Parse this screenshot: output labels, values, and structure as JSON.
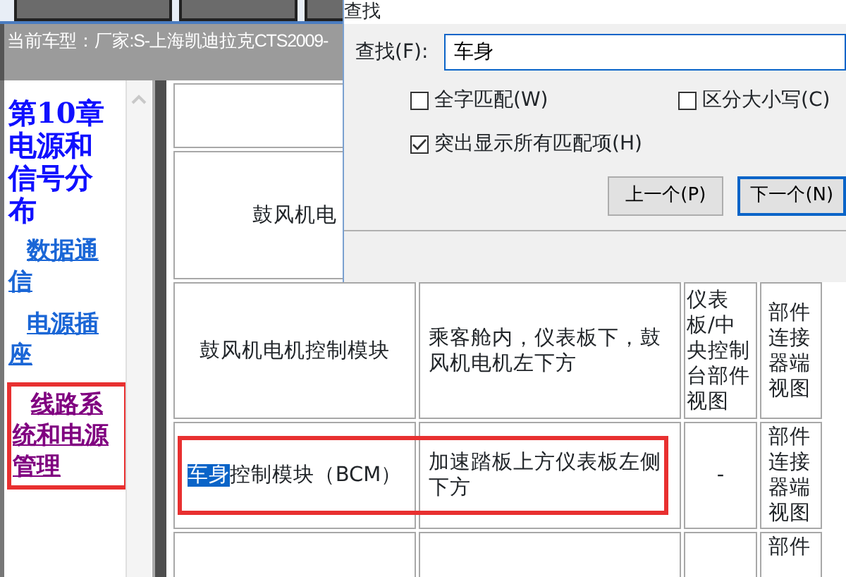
{
  "model_bar": {
    "text": "当前车型：厂家:S-上海凯迪拉克CTS2009-"
  },
  "sidebar": {
    "heading": "第10章电源和信号分布",
    "links": [
      {
        "label": "数据通信",
        "visited": false,
        "annotated": false
      },
      {
        "label": "电源插座",
        "visited": false,
        "annotated": false
      },
      {
        "label": "线路系统和电源管理",
        "visited": true,
        "annotated": true
      }
    ]
  },
  "table": {
    "rows": [
      {
        "column_1": {
          "parts": [
            {
              "text": "鼓风机电",
              "highlighted": false
            }
          ]
        },
        "annotated": false
      },
      {
        "column_1": {
          "parts": [
            {
              "text": "鼓风机电机控制模块",
              "highlighted": false
            }
          ]
        },
        "column_2": "乘客舱内，仪表板下，鼓风机电机左下方",
        "column_3": "仪表板/中央控制台部件视图",
        "column_4": "部件连接器端视图",
        "annotated": false
      },
      {
        "column_1": {
          "parts": [
            {
              "text": "车身",
              "highlighted": true
            },
            {
              "text": "控制模块（BCM）",
              "highlighted": false
            }
          ]
        },
        "column_2": "加速踏板上方仪表板左侧下方",
        "column_3": "-",
        "column_4": "部件连接器端视图",
        "annotated": true
      },
      {
        "column_4": "部件",
        "annotated": false
      }
    ]
  },
  "find_dialog": {
    "title": "查找",
    "find_label": "查找(F):",
    "find_value": "车身",
    "options": [
      {
        "label": "全字匹配(W)",
        "checked": false
      },
      {
        "label": "区分大小写(C)",
        "checked": false
      },
      {
        "label": "突出显示所有匹配项(H)",
        "checked": true
      }
    ],
    "buttons": [
      {
        "label": "上一个(P)",
        "default": false
      },
      {
        "label": "下一个(N)",
        "default": true
      }
    ]
  }
}
